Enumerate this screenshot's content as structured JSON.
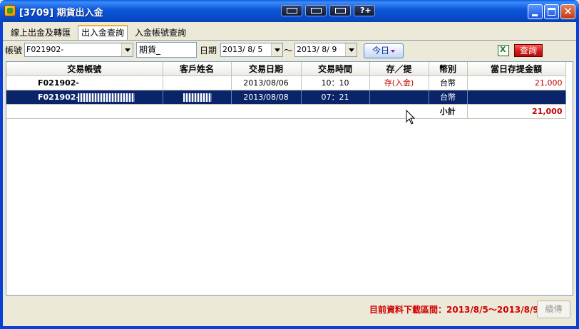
{
  "window": {
    "title": "[3709] 期貨出入金",
    "toolbar_icons": [
      "layout-icon",
      "window-icon",
      "dock-icon",
      "help-icon"
    ],
    "help_label": "?+"
  },
  "tabs": [
    {
      "label": "線上出金及轉匯",
      "active": false
    },
    {
      "label": "出入金查詢",
      "active": true
    },
    {
      "label": "入金帳號查詢",
      "active": false
    }
  ],
  "filters": {
    "account_label": "帳號",
    "account_value": "F021902-",
    "product_value": "期貨_",
    "date_label": "日期",
    "date_from": "2013/ 8/ 5",
    "date_sep": "～",
    "date_to": "2013/ 8/ 9",
    "today_label": "今日",
    "query_label": "查詢"
  },
  "table": {
    "columns": [
      "交易帳號",
      "客戶姓名",
      "交易日期",
      "交易時間",
      "存／提",
      "幣別",
      "當日存提金額"
    ],
    "rows": [
      {
        "account": "F021902-",
        "name": "",
        "date": "2013/08/06",
        "time": "10：10",
        "type": "存(入金)",
        "currency": "台幣",
        "amount": "21,000",
        "selected": false
      },
      {
        "account": "F021902-",
        "name": "",
        "date": "2013/08/08",
        "time": "07：21",
        "type": "",
        "currency": "台幣",
        "amount": "",
        "selected": true
      }
    ],
    "subtotal_label": "小計",
    "subtotal_amount": "21,000"
  },
  "footer": {
    "status": "目前資料下載區間：2013/8/5～2013/8/9",
    "next_label": "續傳"
  },
  "colors": {
    "title_bar": "#0a55d8",
    "selection": "#0a246a",
    "accent_red": "#c00000"
  }
}
